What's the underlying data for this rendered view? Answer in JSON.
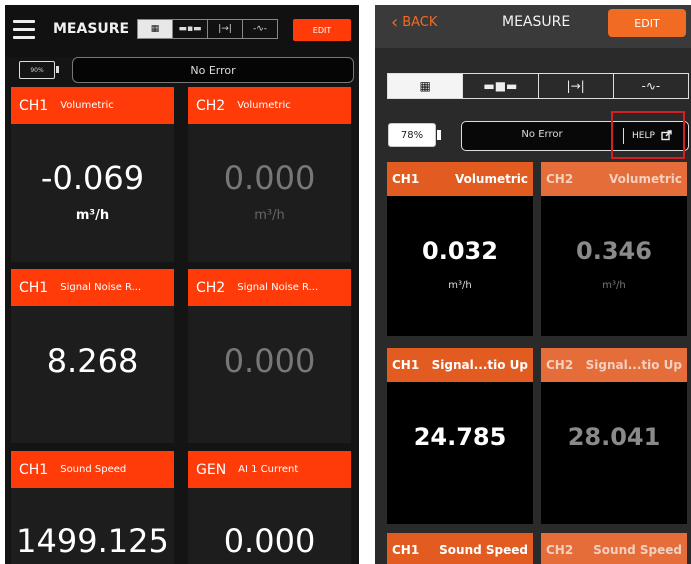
{
  "left": {
    "title": "MEASURE",
    "modes": [
      "▦",
      "▬▪▬",
      "|→|",
      "-∿-"
    ],
    "edit_label": "EDIT",
    "battery": "90%",
    "status": "No Error",
    "tiles": [
      {
        "ch": "CH1",
        "name": "Volumetric",
        "value": "-0.069",
        "unit": "m³/h"
      },
      {
        "ch": "CH2",
        "name": "Volumetric",
        "value": "0.000",
        "unit": "m³/h"
      },
      {
        "ch": "CH1",
        "name": "Signal Noise R...",
        "value": "8.268",
        "unit": ""
      },
      {
        "ch": "CH2",
        "name": "Signal Noise R...",
        "value": "0.000",
        "unit": ""
      },
      {
        "ch": "CH1",
        "name": "Sound Speed",
        "value": "1499.125",
        "unit": ""
      },
      {
        "ch": "GEN",
        "name": "AI 1 Current",
        "value": "0.000",
        "unit": ""
      }
    ]
  },
  "right": {
    "back_label": "BACK",
    "title": "MEASURE",
    "edit_label": "EDIT",
    "modes": [
      "▦",
      "▬■▬",
      "|→|",
      "-∿-"
    ],
    "battery": "78%",
    "status": "No Error",
    "help_label": "HELP",
    "tiles": [
      {
        "ch": "CH1",
        "name": "Volumetric",
        "value": "0.032",
        "unit": "m³/h"
      },
      {
        "ch": "CH2",
        "name": "Volumetric",
        "value": "0.346",
        "unit": "m³/h"
      },
      {
        "ch": "CH1",
        "name": "Signal...tio Up",
        "value": "24.785",
        "unit": ""
      },
      {
        "ch": "CH2",
        "name": "Signal...tio Up",
        "value": "28.041",
        "unit": ""
      },
      {
        "ch": "CH1",
        "name": "Sound Speed",
        "value": "",
        "unit": ""
      },
      {
        "ch": "CH2",
        "name": "Sound Speed",
        "value": "",
        "unit": ""
      }
    ]
  },
  "colors": {
    "accent_left": "#ff3b0a",
    "accent_right": "#e25c22",
    "highlight": "#d42020"
  }
}
